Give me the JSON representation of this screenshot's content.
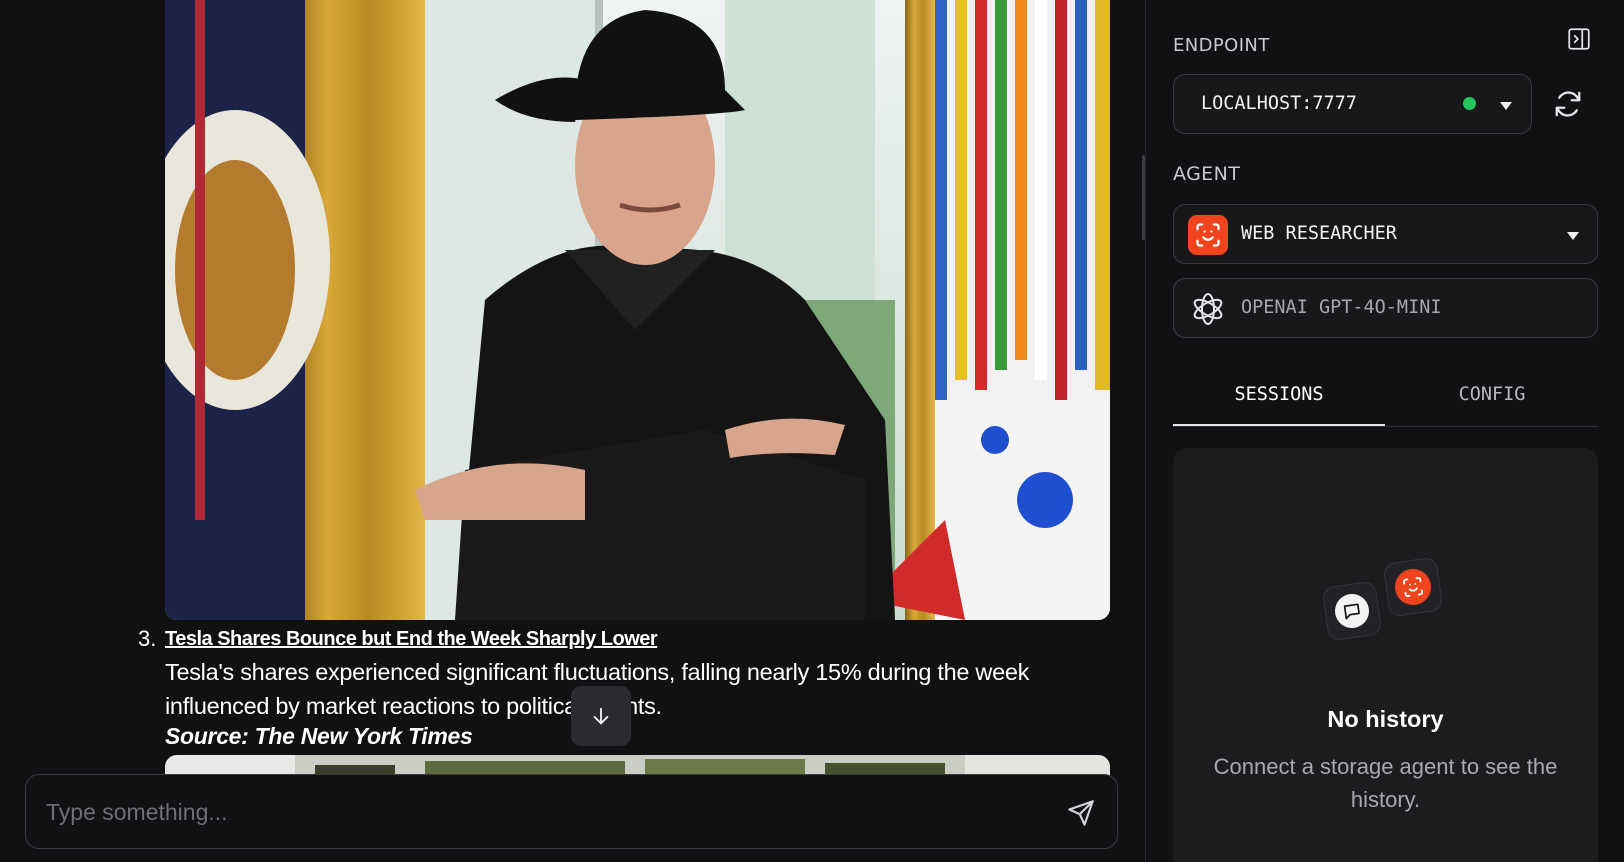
{
  "chat": {
    "list_item": {
      "number": "3.",
      "title": "Tesla Shares Bounce but End the Week Sharply Lower",
      "body": "Tesla's shares experienced significant fluctuations, falling nearly 15% during the week influenced by market reactions to political events.",
      "source": "Source: The New York Times"
    },
    "scroll_down_icon": "arrow-down-icon",
    "input": {
      "placeholder": "Type something...",
      "value": ""
    },
    "send_icon": "send-icon"
  },
  "sidebar": {
    "endpoint": {
      "label": "ENDPOINT",
      "value": "LOCALHOST:7777",
      "status_color": "#22c55e",
      "refresh_icon": "refresh-icon",
      "toggle_icon": "panel-toggle-icon"
    },
    "agent": {
      "label": "AGENT",
      "value": "WEB RESEARCHER",
      "icon_color": "#f0441e",
      "model": "OPENAI GPT-4O-MINI"
    },
    "tabs": [
      {
        "label": "SESSIONS",
        "active": true
      },
      {
        "label": "CONFIG",
        "active": false
      }
    ],
    "history": {
      "title": "No history",
      "subtitle": "Connect a storage agent to see the history."
    }
  },
  "colors": {
    "background": "#111113",
    "accent": "#f0441e",
    "status_green": "#22c55e"
  }
}
